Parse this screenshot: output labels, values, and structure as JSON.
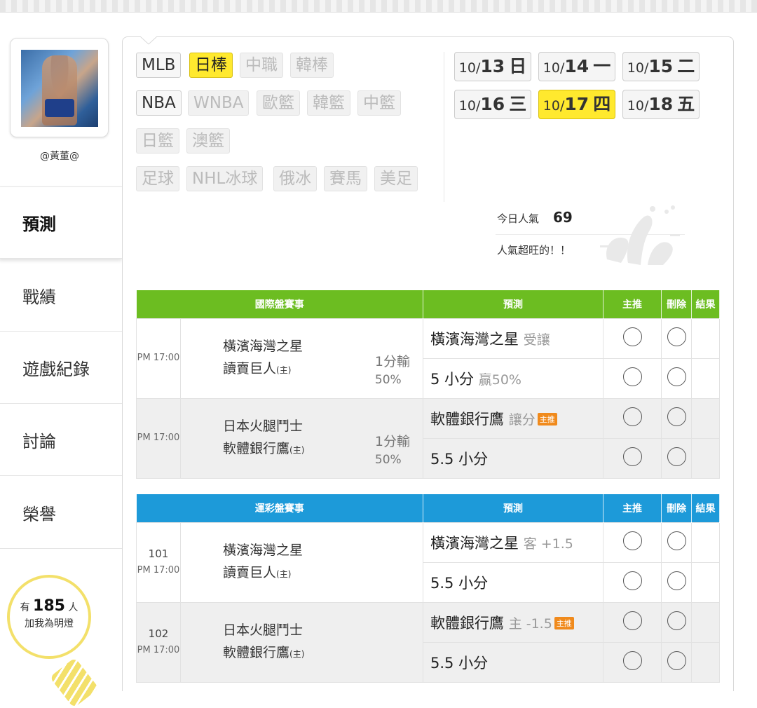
{
  "profile": {
    "username": "@黃董@"
  },
  "nav": {
    "items": [
      {
        "label": "預測",
        "active": true
      },
      {
        "label": "戰績"
      },
      {
        "label": "遊戲紀錄"
      },
      {
        "label": "討論"
      },
      {
        "label": "榮譽"
      }
    ]
  },
  "fans": {
    "prefix": "有",
    "count": "185",
    "suffix": "人",
    "line2": "加我為明燈"
  },
  "leagues": [
    {
      "label": "MLB",
      "state": "enabled"
    },
    {
      "label": "日棒",
      "state": "selected"
    },
    {
      "label": "中職",
      "state": "disabled"
    },
    {
      "label": "韓棒",
      "state": "disabled"
    },
    {
      "label": "NBA",
      "state": "enabled"
    },
    {
      "label": "WNBA",
      "state": "disabled"
    },
    {
      "label": "歐籃",
      "state": "disabled"
    },
    {
      "label": "韓籃",
      "state": "disabled"
    },
    {
      "label": "中籃",
      "state": "disabled"
    },
    {
      "label": "日籃",
      "state": "disabled"
    },
    {
      "label": "澳籃",
      "state": "disabled"
    },
    {
      "label": "足球",
      "state": "disabled"
    },
    {
      "label": "NHL冰球",
      "state": "disabled"
    },
    {
      "label": "俄冰",
      "state": "disabled"
    },
    {
      "label": "賽馬",
      "state": "disabled"
    },
    {
      "label": "美足",
      "state": "disabled"
    }
  ],
  "dates": [
    {
      "md": "10/",
      "day": "13",
      "wd": "日"
    },
    {
      "md": "10/",
      "day": "14",
      "wd": "一"
    },
    {
      "md": "10/",
      "day": "15",
      "wd": "二"
    },
    {
      "md": "10/",
      "day": "16",
      "wd": "三"
    },
    {
      "md": "10/",
      "day": "17",
      "wd": "四",
      "selected": true
    },
    {
      "md": "10/",
      "day": "18",
      "wd": "五"
    }
  ],
  "popularity": {
    "label": "今日人氣",
    "value": "69",
    "message": "人氣超旺的！！"
  },
  "columns": {
    "prediction": "預測",
    "main_pick": "主推",
    "delete": "刪除",
    "result": "結果"
  },
  "intl": {
    "title": "國際盤賽事",
    "games": [
      {
        "time": "PM 17:00",
        "away": "橫濱海灣之星",
        "home": "讀賣巨人",
        "host_mark": "(主)",
        "odds": "1分輸",
        "odds_pct": "50%",
        "picks": [
          {
            "main": "橫濱海灣之星",
            "sub": "受讓",
            "badge": ""
          },
          {
            "main": "5 小分",
            "sub": "贏50%",
            "badge": ""
          }
        ]
      },
      {
        "time": "PM 17:00",
        "away": "日本火腿鬥士",
        "home": "軟體銀行鷹",
        "host_mark": "(主)",
        "odds": "1分輸",
        "odds_pct": "50%",
        "picks": [
          {
            "main": "軟體銀行鷹",
            "sub": "讓分",
            "badge": "主推"
          },
          {
            "main": "5.5 小分",
            "sub": "",
            "badge": ""
          }
        ]
      }
    ]
  },
  "sports": {
    "title": "運彩盤賽事",
    "games": [
      {
        "num": "101",
        "time": "PM 17:00",
        "away": "橫濱海灣之星",
        "home": "讀賣巨人",
        "host_mark": "(主)",
        "picks": [
          {
            "main": "橫濱海灣之星",
            "sub": "客 +1.5",
            "badge": ""
          },
          {
            "main": "5.5 小分",
            "sub": "",
            "badge": ""
          }
        ]
      },
      {
        "num": "102",
        "time": "PM 17:00",
        "away": "日本火腿鬥士",
        "home": "軟體銀行鷹",
        "host_mark": "(主)",
        "picks": [
          {
            "main": "軟體銀行鷹",
            "sub": "主 -1.5",
            "badge": "主推"
          },
          {
            "main": "5.5 小分",
            "sub": "",
            "badge": ""
          }
        ]
      }
    ]
  }
}
